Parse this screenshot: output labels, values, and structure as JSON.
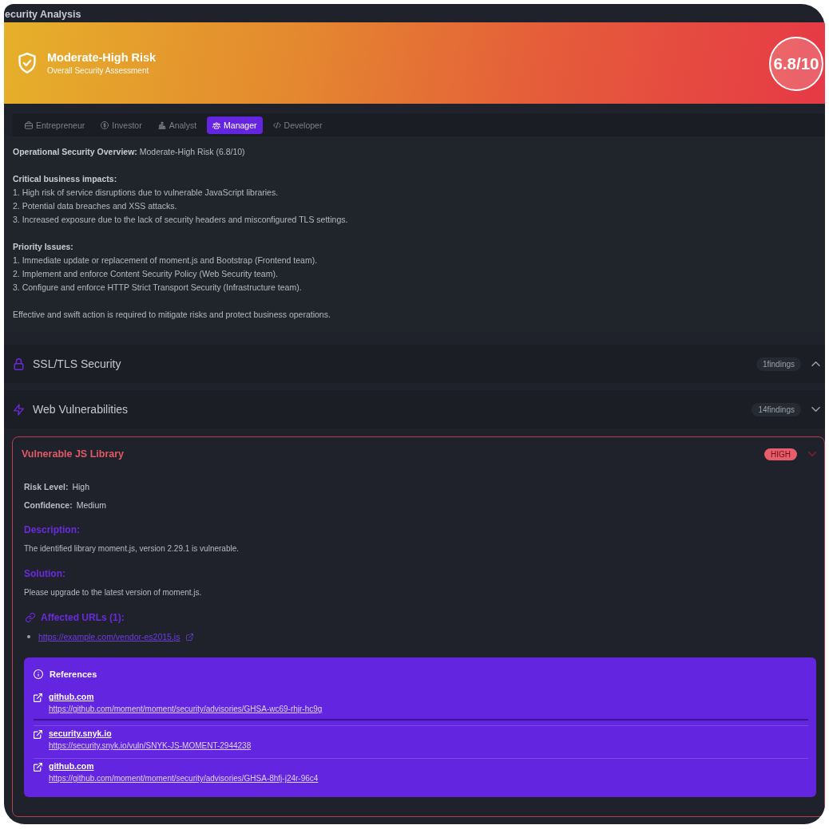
{
  "window": {
    "title": "ecurity Analysis"
  },
  "assessment": {
    "title": "Moderate-High Risk",
    "subtitle": "Overall Security Assessment",
    "score": "6.8/10"
  },
  "tabs": [
    {
      "label": "Entrepreneur",
      "selected": false
    },
    {
      "label": "Investor",
      "selected": false
    },
    {
      "label": "Analyst",
      "selected": false
    },
    {
      "label": "Manager",
      "selected": true
    },
    {
      "label": "Developer",
      "selected": false
    }
  ],
  "overview": {
    "lead": "**Operational Security Overview:** Moderate-High Risk (6.8/10)",
    "sections": [
      {
        "heading": "Critical business impacts:",
        "items": [
          "1. High risk of service disruptions due to vulnerable JavaScript libraries.",
          "2. Potential data breaches and XSS attacks.",
          "3. Increased exposure due to the lack of security headers and misconfigured TLS settings."
        ]
      },
      {
        "heading": "Priority Issues:",
        "items": [
          "1. Immediate update or replacement of moment.js and Bootstrap (Frontend team).",
          "2. Implement and enforce Content Security Policy (Web Security team).",
          "3. Configure and enforce HTTP Strict Transport Security (Infrastructure team)."
        ]
      }
    ],
    "closing": "Effective and swift action is required to mitigate risks and protect business operations."
  },
  "categories": [
    {
      "title": "SSL/TLS Security",
      "count": "1findings",
      "expanded": false
    },
    {
      "title": "Web Vulnerabilities",
      "count": "14findings",
      "expanded": true,
      "findings": [
        {
          "title": "Vulnerable JS Library",
          "severity": "HIGH",
          "expanded": true,
          "details": [
            {
              "label": "Risk Level:",
              "value": "High"
            },
            {
              "label": "Confidence:",
              "value": "Medium"
            }
          ],
          "description": {
            "heading": "Description:",
            "text": "The identified library moment.js, version 2.29.1 is vulnerable."
          },
          "solution": {
            "heading": "Solution:",
            "text": "Please upgrade to the latest version of moment.js."
          },
          "affected": {
            "heading": "Affected URLs (1):",
            "urls": [
              "https://example.com/vendor-es2015.js"
            ]
          },
          "references": {
            "heading": "References",
            "items": [
              {
                "site": "github.com",
                "url": "https://github.com/moment/moment/security/advisories/GHSA-wc69-rhjr-hc9g"
              },
              {
                "site": "security.snyk.io",
                "url": "https://security.snyk.io/vuln/SNYK-JS-MOMENT-2944238"
              },
              {
                "site": "github.com",
                "url": "https://github.com/moment/moment/security/advisories/GHSA-8hfj-j24r-96c4"
              }
            ]
          }
        }
      ]
    }
  ]
}
